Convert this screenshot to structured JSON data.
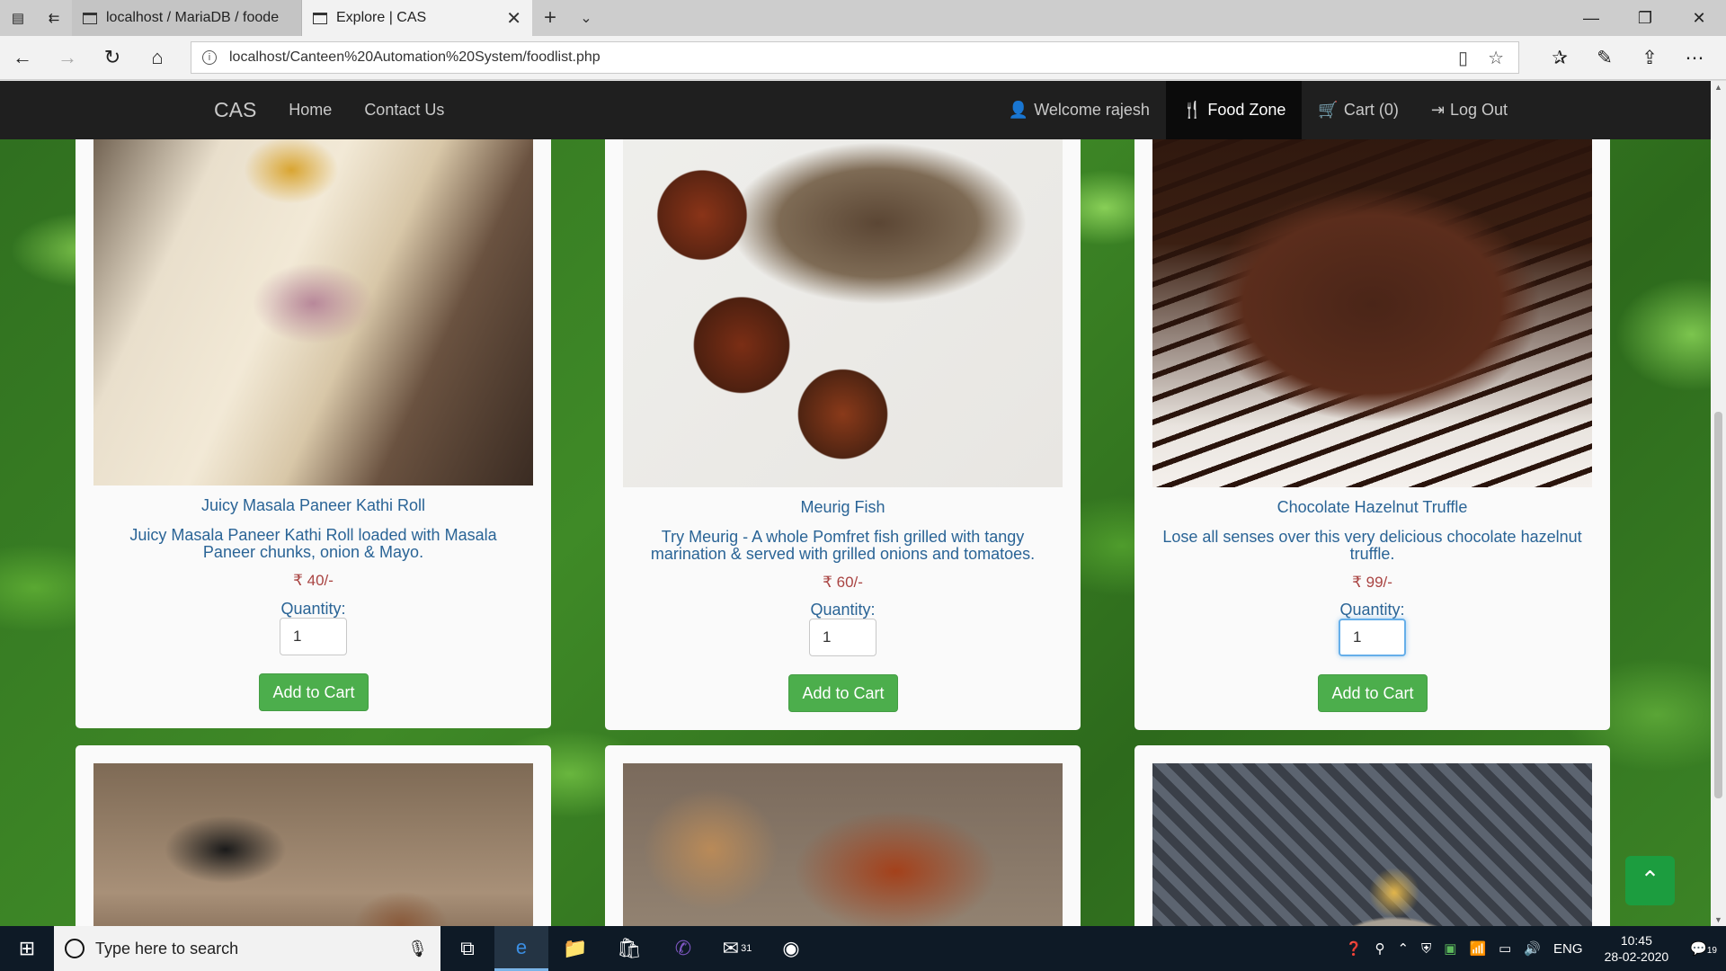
{
  "browser": {
    "tabs": [
      {
        "title": "localhost / MariaDB / foode",
        "active": false
      },
      {
        "title": "Explore | CAS",
        "active": true
      }
    ],
    "url": "localhost/Canteen%20Automation%20System/foodlist.php"
  },
  "site": {
    "brand": "CAS",
    "nav": {
      "home": "Home",
      "contact": "Contact Us"
    },
    "right": {
      "welcome": "Welcome rajesh",
      "food_zone": "Food Zone",
      "cart": "Cart (0)",
      "logout": "Log Out"
    }
  },
  "foods": [
    {
      "name": "Juicy Masala Paneer Kathi Roll",
      "description": "Juicy Masala Paneer Kathi Roll loaded with Masala Paneer chunks, onion & Mayo.",
      "price": "₹ 40/-",
      "qty_label": "Quantity:",
      "quantity": "1",
      "button": "Add to Cart"
    },
    {
      "name": "Meurig Fish",
      "description": "Try Meurig - A whole Pomfret fish grilled with tangy marination & served with grilled onions and tomatoes.",
      "price": "₹ 60/-",
      "qty_label": "Quantity:",
      "quantity": "1",
      "button": "Add to Cart"
    },
    {
      "name": "Chocolate Hazelnut Truffle",
      "description": "Lose all senses over this very delicious chocolate hazelnut truffle.",
      "price": "₹ 99/-",
      "qty_label": "Quantity:",
      "quantity": "1",
      "button": "Add to Cart"
    }
  ],
  "taskbar": {
    "search_placeholder": "Type here to search",
    "mail_badge": "31",
    "lang": "ENG",
    "time": "10:45",
    "date": "28-02-2020",
    "notifications": "19"
  },
  "colors": {
    "navbar": "#1f1f1f",
    "link": "#2a6496",
    "price": "#a94442",
    "button": "#4cae4c",
    "scroll_top": "#1c9d3f"
  }
}
